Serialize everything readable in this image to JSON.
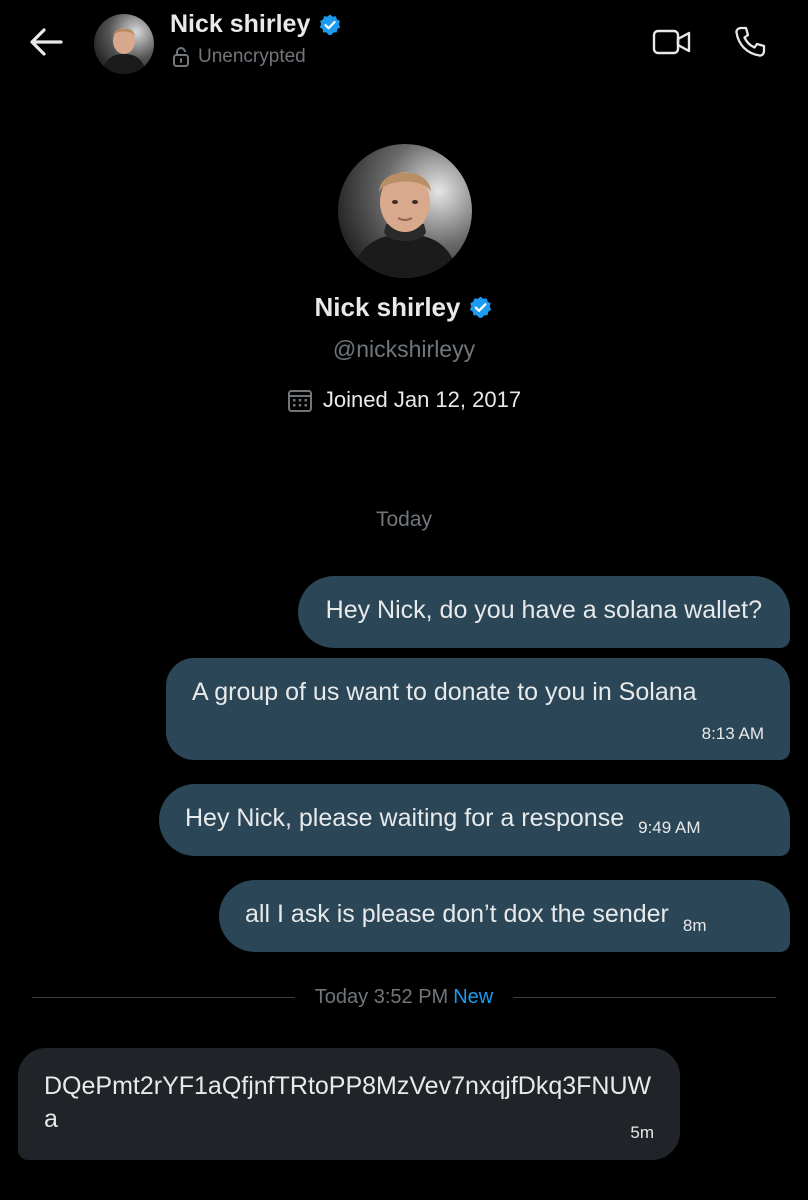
{
  "header": {
    "name": "Nick shirley",
    "encryption_status": "Unencrypted",
    "icons": {
      "back": "arrow-left-icon",
      "verified": "verified-badge-icon",
      "lock": "unlock-icon",
      "video": "video-call-icon",
      "phone": "phone-call-icon"
    }
  },
  "profile": {
    "name": "Nick shirley",
    "handle": "@nickshirleyy",
    "joined": "Joined Jan 12, 2017",
    "icons": {
      "calendar": "calendar-icon"
    }
  },
  "conversation": {
    "date_label": "Today",
    "sent_messages": [
      {
        "text": "Hey Nick, do you have a solana wallet?",
        "time": ""
      },
      {
        "text": "A group of us want to donate to you in Solana",
        "time": "8:13 AM"
      },
      {
        "text": "Hey Nick, please waiting for a response",
        "time": "9:49 AM"
      },
      {
        "text": "all I ask is please don’t dox the sender",
        "time": "8m"
      }
    ],
    "new_divider": {
      "time": "Today 3:52 PM",
      "label": "New"
    },
    "received_messages": [
      {
        "text": "DQePmt2rYF1aQfjnfTRtoPP8MzVev7nxqjfDkq3FNUWa",
        "time": "5m"
      }
    ]
  },
  "colors": {
    "background": "#000000",
    "sent_bubble": "#2b4656",
    "received_bubble": "#202327",
    "secondary_text": "#71767b",
    "accent_blue": "#1d9bf0"
  }
}
